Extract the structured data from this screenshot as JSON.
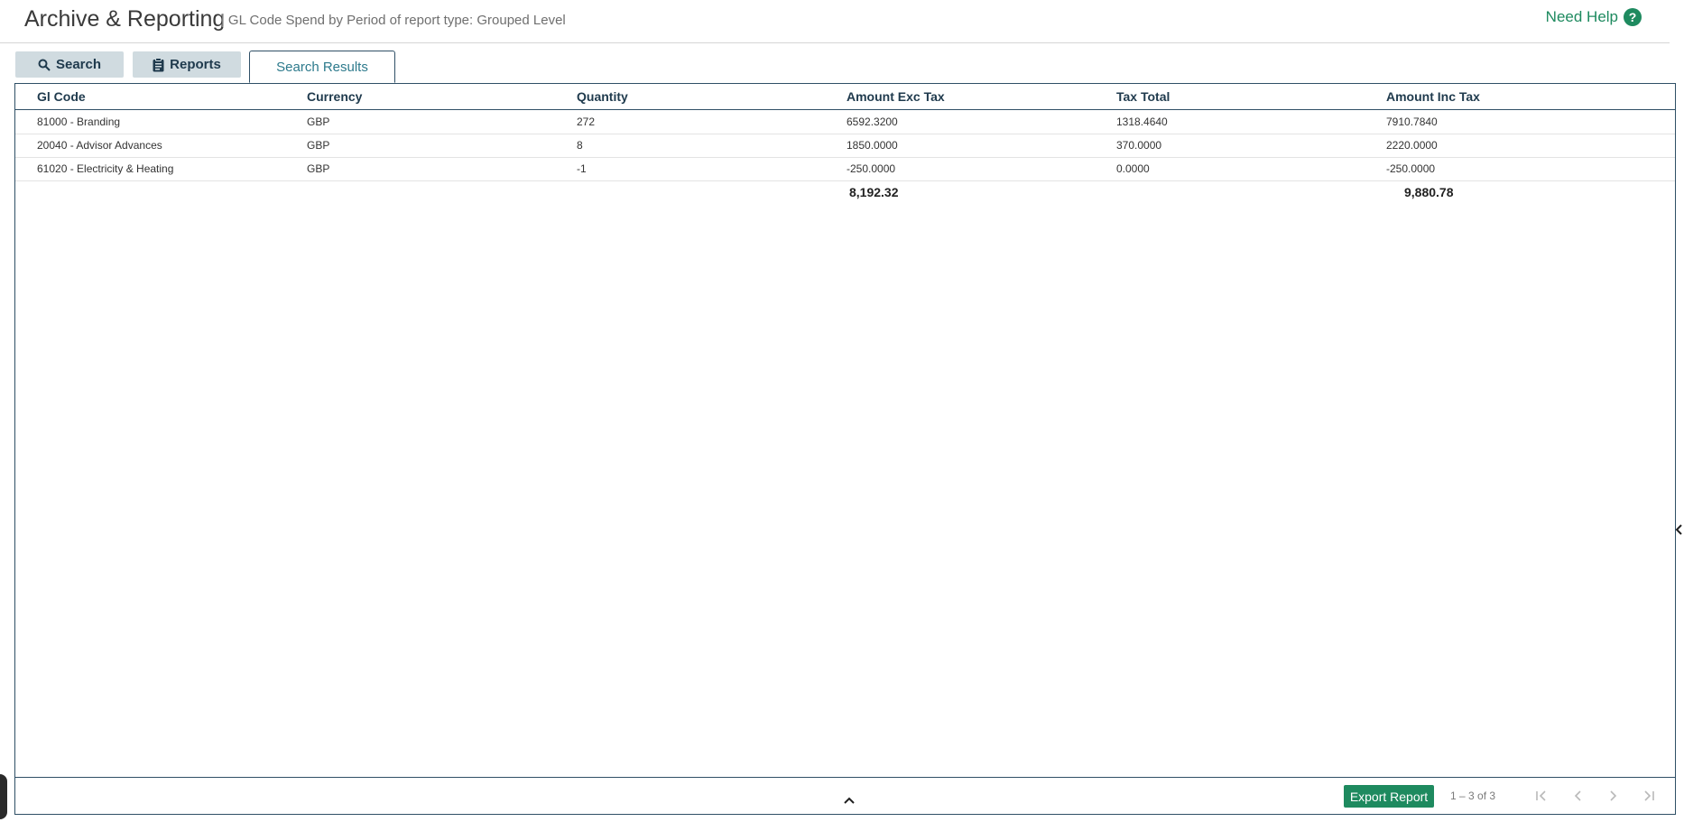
{
  "header": {
    "title": "Archive & Reporting",
    "separator": "|",
    "subtitle": "GL Code Spend by Period of report type: Grouped Level",
    "help_label": "Need Help",
    "help_icon": "question-circle-icon",
    "accent_color": "#1e8a5f"
  },
  "tabs": {
    "search": {
      "label": "Search",
      "icon": "search-icon"
    },
    "reports": {
      "label": "Reports",
      "icon": "clipboard-icon"
    },
    "results": {
      "label": "Search Results",
      "active": true
    }
  },
  "table": {
    "columns": [
      "Gl Code",
      "Currency",
      "Quantity",
      "Amount Exc Tax",
      "Tax Total",
      "Amount Inc Tax"
    ],
    "rows": [
      [
        "81000 - Branding",
        "GBP",
        "272",
        "6592.3200",
        "1318.4640",
        "7910.7840"
      ],
      [
        "20040 - Advisor Advances",
        "GBP",
        "8",
        "1850.0000",
        "370.0000",
        "2220.0000"
      ],
      [
        "61020 - Electricity & Heating",
        "GBP",
        "-1",
        "-250.0000",
        "0.0000",
        "-250.0000"
      ]
    ],
    "totals": {
      "amount_exc_tax": "8,192.32",
      "amount_inc_tax": "9,880.78"
    }
  },
  "footer": {
    "export_label": "Export Report",
    "range_text": "1 – 3 of 3",
    "pager_icons": [
      "first-page-icon",
      "previous-page-icon",
      "next-page-icon",
      "last-page-icon"
    ]
  }
}
